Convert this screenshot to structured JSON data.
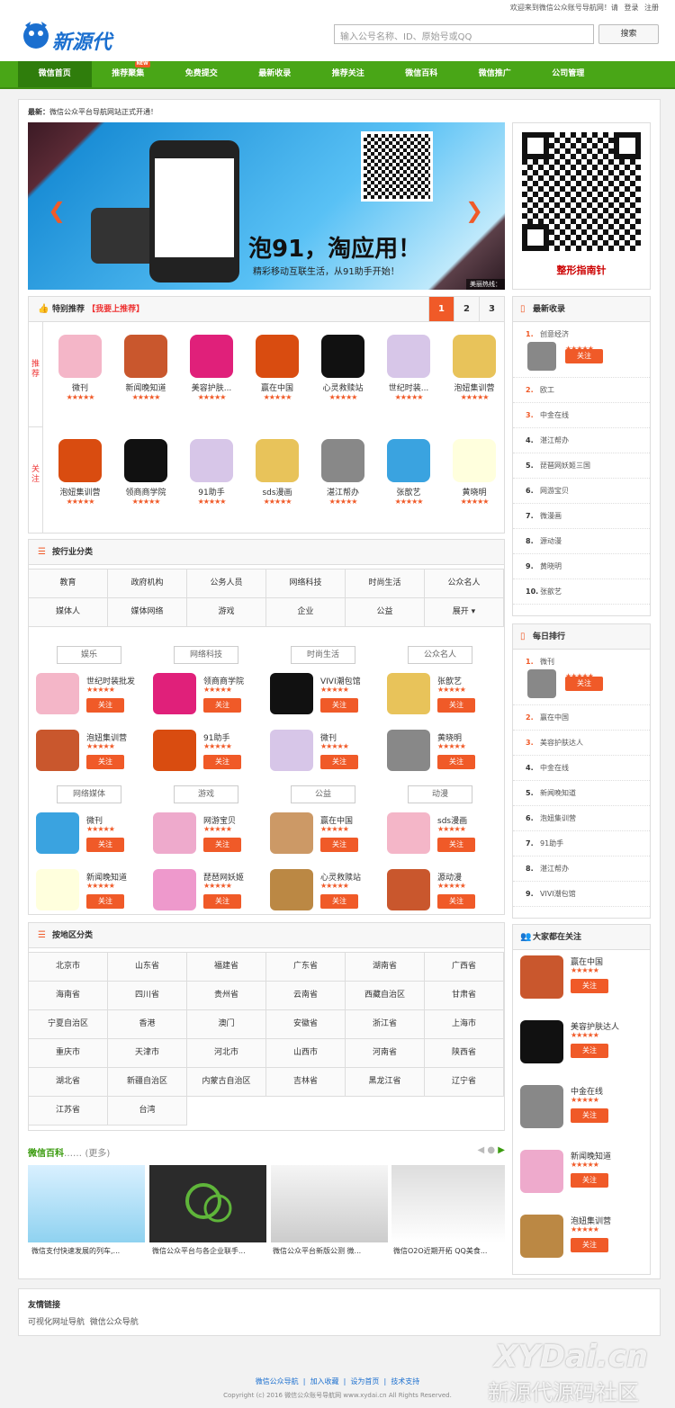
{
  "topbar": {
    "welcome": "欢迎来到微信公众账号导航网！请",
    "login": "登录",
    "register": "注册"
  },
  "logo": {
    "text": "新源代"
  },
  "search": {
    "placeholder": "输入公号名称、ID、原始号或QQ",
    "button": "搜索"
  },
  "nav": [
    "微信首页",
    "推荐聚集",
    "免费提交",
    "最新收录",
    "推荐关注",
    "微信百科",
    "微信推广",
    "公司管理"
  ],
  "nav_new_badge": "NEW",
  "latest": {
    "label": "最新：",
    "text": "微信公众平台导航网站正式开通！"
  },
  "banner": {
    "slogan": "泡91，淘应用！",
    "sub": "精彩移动互联生活，从91助手开始！",
    "hotline": "美丽热线："
  },
  "qr_caption": "整形指南针",
  "featured": {
    "title": "特别推荐",
    "link": "【我要上推荐】",
    "pages": [
      "1",
      "2",
      "3"
    ],
    "row1_label": "推荐",
    "row2_label": "关注",
    "row1": [
      "微刊",
      "新闻晚知道",
      "美容护肤...",
      "赢在中国",
      "心灵救赎站",
      "世纪时装...",
      "泡妞集训营"
    ],
    "row2": [
      "泡妞集训营",
      "领商商学院",
      "91助手",
      "sds漫画",
      "湛江帮办",
      "张歆艺",
      "黄晓明"
    ]
  },
  "industry": {
    "title": "按行业分类",
    "cats": [
      "教育",
      "政府机构",
      "公务人员",
      "网络科技",
      "时尚生活",
      "公众名人",
      "媒体人",
      "媒体网络",
      "游戏",
      "企业",
      "公益",
      "展开 ▾"
    ],
    "groups": [
      {
        "tag": "娱乐",
        "items": [
          {
            "name": "世纪时装批发",
            "star": "★★★★★"
          },
          {
            "name": "泡妞集训营",
            "star": "★★★★★"
          }
        ]
      },
      {
        "tag": "网络科技",
        "items": [
          {
            "name": "领商商学院",
            "star": "★★★★★"
          },
          {
            "name": "91助手",
            "star": "★★★★★"
          }
        ]
      },
      {
        "tag": "时尚生活",
        "items": [
          {
            "name": "VIVI潮包馆",
            "star": "★★★★★"
          },
          {
            "name": "微刊",
            "star": "★★★★★"
          }
        ]
      },
      {
        "tag": "公众名人",
        "items": [
          {
            "name": "张歆艺",
            "star": "★★★★★"
          },
          {
            "name": "黄晓明",
            "star": "★★★★★"
          }
        ]
      },
      {
        "tag": "网络媒体",
        "items": [
          {
            "name": "微刊",
            "star": "★★★★★"
          },
          {
            "name": "新闻晚知道",
            "star": "★★★★★"
          }
        ]
      },
      {
        "tag": "游戏",
        "items": [
          {
            "name": "网游宝贝",
            "star": "★★★★★"
          },
          {
            "name": "琵琶网妖姬",
            "star": "★★★★★"
          }
        ]
      },
      {
        "tag": "公益",
        "items": [
          {
            "name": "赢在中国",
            "star": "★★★★★"
          },
          {
            "name": "心灵救赎站",
            "star": "★★★★★"
          }
        ]
      },
      {
        "tag": "动漫",
        "items": [
          {
            "name": "sds漫画",
            "star": "★★★★★"
          },
          {
            "name": "源动漫",
            "star": "★★★★★"
          }
        ]
      }
    ]
  },
  "region": {
    "title": "按地区分类",
    "cells": [
      "北京市",
      "山东省",
      "福建省",
      "广东省",
      "湖南省",
      "广西省",
      "海南省",
      "四川省",
      "贵州省",
      "云南省",
      "西藏自治区",
      "甘肃省",
      "宁夏自治区",
      "香港",
      "澳门",
      "安徽省",
      "浙江省",
      "上海市",
      "重庆市",
      "天津市",
      "河北市",
      "山西市",
      "河南省",
      "陕西省",
      "湖北省",
      "新疆自治区",
      "内蒙古自治区",
      "吉林省",
      "黑龙江省",
      "辽宁省",
      "江苏省",
      "台湾"
    ]
  },
  "wiki": {
    "title": "微信百科",
    "more": "(更多)",
    "dots": "……",
    "items": [
      "微信支付快速发展的列车,...",
      "微信公众平台与各企业联手...",
      "微信公众平台新版公测 微...",
      "微信O2O近期开拓 QQ美食..."
    ]
  },
  "follow_label": "关注",
  "stars": "★★★★★",
  "latest_side": {
    "title": "最新收录",
    "items": [
      "创意经济",
      "欧工",
      "中金在线",
      "湛江帮办",
      "琵琶网妖姬三国",
      "网游宝贝",
      "微漫画",
      "源动漫",
      "黄晓明",
      "张歆艺"
    ]
  },
  "daily": {
    "title": "每日排行",
    "items": [
      "微刊",
      "赢在中国",
      "美容护肤达人",
      "中金在线",
      "新闻晚知道",
      "泡妞集训营",
      "91助手",
      "湛江帮办",
      "VIVI潮包馆"
    ]
  },
  "everyone": {
    "title": "大家都在关注",
    "items": [
      "赢在中国",
      "美容护肤达人",
      "中金在线",
      "新闻晚知道",
      "泡妞集训营"
    ]
  },
  "links": {
    "title": "友情链接",
    "items": [
      "可视化网址导航",
      "微信公众导航"
    ]
  },
  "footer": {
    "links": [
      "微信公众导航",
      "加入收藏",
      "设为首页",
      "技术支持"
    ],
    "copyright": "Copyright (c) 2016 微信公众账号导航网 www.xydai.cn All Rights Reserved."
  },
  "watermark": {
    "line1": "XYDai.cn",
    "line2": "新源代源码社区"
  },
  "colors": {
    "green": "#49a617",
    "orange": "#f05a28",
    "red": "#e33"
  }
}
